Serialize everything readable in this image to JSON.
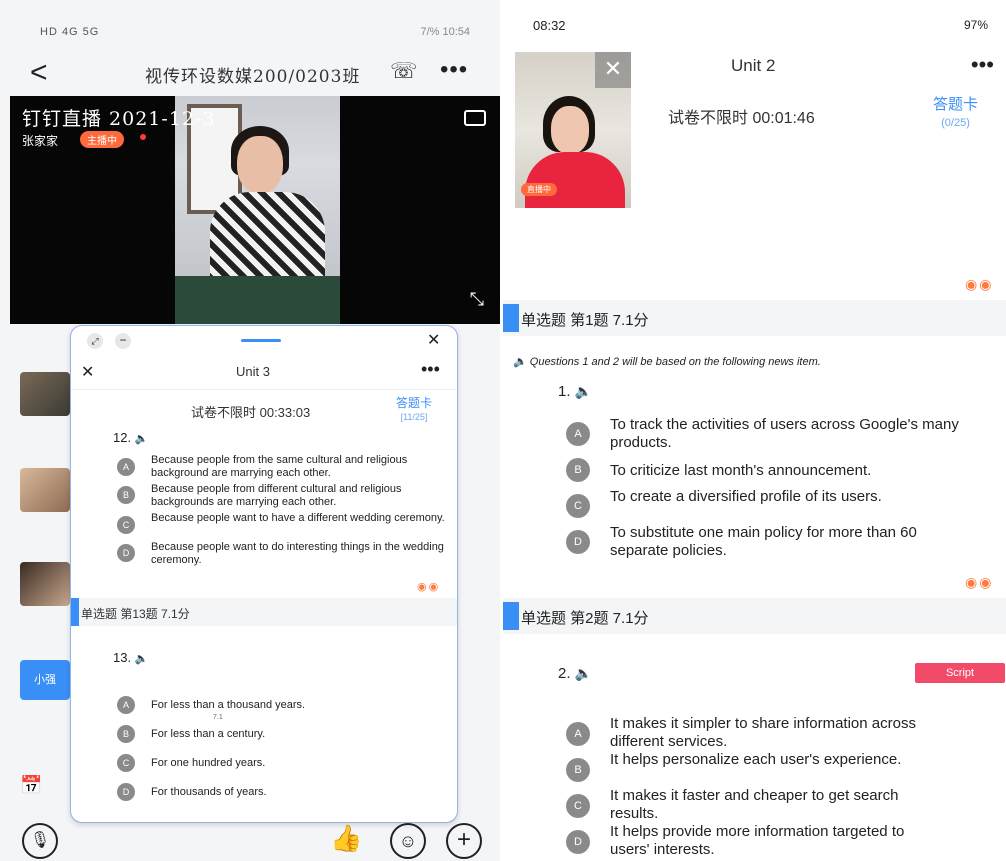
{
  "left": {
    "status": {
      "left_text": "HD 4G 5G",
      "right_text": "7/% 10:54"
    },
    "header": {
      "title": "视传环设数媒200/0203班",
      "back_label": "<",
      "call_label": "☏",
      "more_label": "•••"
    },
    "live": {
      "title": "钉钉直播 2021-12-3",
      "presenter": "张家家",
      "badge": "主播中"
    },
    "chat_button": "小强",
    "float_window": {
      "unit_title": "Unit 3",
      "timer": "试卷不限时  00:33:03",
      "answer_card": {
        "label": "答题卡",
        "progress": "[11/25]"
      },
      "q12": {
        "number": "12.",
        "options": [
          {
            "letter": "A",
            "text": "Because people from the same cultural and religious background are marrying each other."
          },
          {
            "letter": "B",
            "text": "Because people from different cultural and religious backgrounds are marrying each other."
          },
          {
            "letter": "C",
            "text": "Because people want to have a different wedding ceremony."
          },
          {
            "letter": "D",
            "text": "Because people want to do interesting things in the wedding ceremony."
          }
        ]
      },
      "section": "单选题 第13题  7.1分",
      "q13": {
        "number": "13.",
        "score_note": "7.1",
        "options": [
          {
            "letter": "A",
            "text": "For less than a thousand years."
          },
          {
            "letter": "B",
            "text": "For less than a century."
          },
          {
            "letter": "C",
            "text": "For one hundred years."
          },
          {
            "letter": "D",
            "text": "For thousands of years."
          }
        ]
      }
    }
  },
  "right": {
    "status": {
      "time": "08:32",
      "right_text": "97%"
    },
    "header": {
      "unit_title": "Unit 2",
      "more_label": "•••"
    },
    "video_badge": "直播中",
    "timer": "试卷不限时  00:01:46",
    "answer_card": {
      "label": "答题卡",
      "progress": "(0/25)"
    },
    "section1": "单选题 第1题  7.1分",
    "instruction": "Questions 1 and 2 will be based on the following news item.",
    "q1": {
      "number": "1.",
      "options": [
        {
          "letter": "A",
          "text": "To track the activities of users across Google's many products."
        },
        {
          "letter": "B",
          "text": "To criticize last month's announcement."
        },
        {
          "letter": "C",
          "text": "To create a diversified profile of its users."
        },
        {
          "letter": "D",
          "text": "To substitute one main policy for more than 60 separate policies."
        }
      ]
    },
    "section2": "单选题 第2题  7.1分",
    "q2": {
      "number": "2.",
      "script_label": "Script",
      "options": [
        {
          "letter": "A",
          "text": "It makes it simpler to share information across different services."
        },
        {
          "letter": "B",
          "text": "It helps personalize each user's experience."
        },
        {
          "letter": "C",
          "text": "It makes it faster and cheaper to get search results."
        },
        {
          "letter": "D",
          "text": "It helps provide more information targeted to users' interests."
        }
      ]
    }
  }
}
